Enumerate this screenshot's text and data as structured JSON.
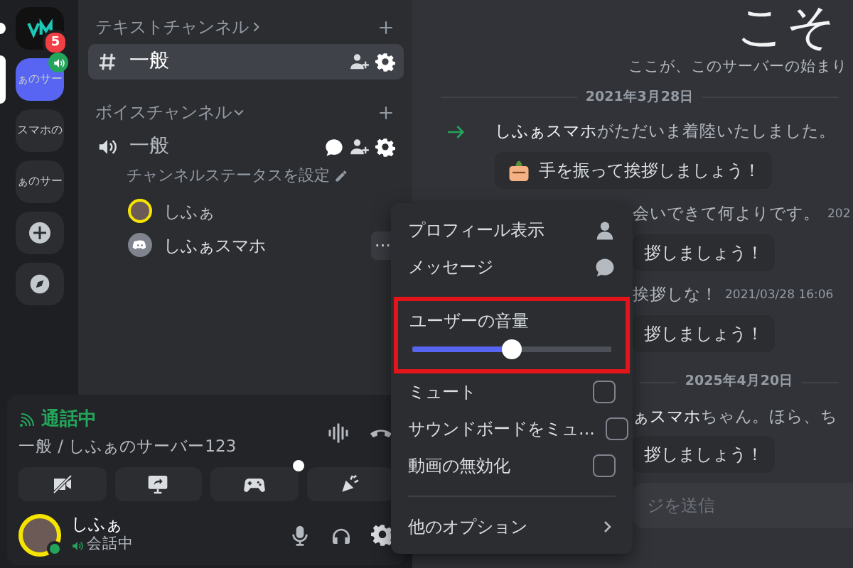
{
  "server_rail": [
    {
      "kind": "logo",
      "badge": "5",
      "selected": false,
      "unread": true,
      "voice_active": false
    },
    {
      "kind": "text",
      "label": "ぁのサー",
      "selected": true,
      "unread": false,
      "voice_active": true
    },
    {
      "kind": "text",
      "label": "スマホの",
      "selected": false,
      "unread": false,
      "voice_active": false
    },
    {
      "kind": "text",
      "label": "ぁのサー",
      "selected": false,
      "unread": false,
      "voice_active": false
    },
    {
      "kind": "add",
      "selected": false,
      "unread": false,
      "voice_active": false
    },
    {
      "kind": "discover",
      "selected": false,
      "unread": false,
      "voice_active": false
    }
  ],
  "channel_sidebar": {
    "categories": [
      {
        "label": "テキストチャンネル",
        "expanded": false,
        "channels": [
          {
            "kind": "text",
            "name": "一般",
            "selected": true
          }
        ]
      },
      {
        "label": "ボイスチャンネル",
        "expanded": true,
        "channels": [
          {
            "kind": "voice",
            "name": "一般",
            "selected": false,
            "status_hint": "チャンネルステータスを設定",
            "members": [
              {
                "kind": "photo",
                "name": "しふぁ",
                "menu_open": false
              },
              {
                "kind": "default",
                "name": "しふぁスマホ",
                "menu_open": true,
                "menu_button": "···"
              }
            ]
          }
        ]
      }
    ]
  },
  "voice_panel": {
    "status": "通話中",
    "location": "一般 / しふぁのサーバー123",
    "buttons": [
      {
        "kind": "camera_off",
        "dot": false
      },
      {
        "kind": "screen_share",
        "dot": false
      },
      {
        "kind": "activity",
        "dot": true
      },
      {
        "kind": "soundboard",
        "dot": false
      }
    ]
  },
  "user_panel": {
    "name": "しふぁ",
    "status": "会話中"
  },
  "chat": {
    "welcome_title": "こそ",
    "welcome_subtitle": "ここが、このサーバーの始まり",
    "items": [
      {
        "kind": "divider",
        "label": "2021年3月28日"
      },
      {
        "kind": "join",
        "user": "しふぁスマホ",
        "text": "がただいま着陸いたしました。",
        "covered": false
      },
      {
        "kind": "wave",
        "label": "手を振って挨拶しましょう！",
        "covered": false
      },
      {
        "kind": "join",
        "text": "会いできて何よりです。",
        "time": "202",
        "covered": true
      },
      {
        "kind": "wave",
        "label": "拶しましょう！",
        "covered": true
      },
      {
        "kind": "join",
        "text": "挨拶しな！",
        "time": "2021/03/28 16:06",
        "covered": true
      },
      {
        "kind": "wave",
        "label": "拶しましょう！",
        "covered": true
      },
      {
        "kind": "divider",
        "label": "2025年4月20日"
      },
      {
        "kind": "join",
        "user": "ぁスマホ",
        "text": "ちゃん。ほら、ち",
        "covered": true
      },
      {
        "kind": "wave",
        "label": "拶しましょう！",
        "covered": true
      }
    ],
    "composer": {
      "placeholder": "ジを送信"
    }
  },
  "context_menu": [
    {
      "kind": "profile",
      "label": "プロフィール表示"
    },
    {
      "kind": "message",
      "label": "メッセージ"
    },
    {
      "kind": "slider",
      "label": "ユーザーの音量",
      "level": 0.5,
      "highlighted": true
    },
    {
      "kind": "checkbox",
      "label": "ミュート",
      "checked": false
    },
    {
      "kind": "checkbox",
      "label": "サウンドボードをミュ...",
      "checked": false
    },
    {
      "kind": "checkbox",
      "label": "動画の無効化",
      "checked": false
    },
    {
      "kind": "divider"
    },
    {
      "kind": "submenu",
      "label": "他のオプション"
    }
  ]
}
